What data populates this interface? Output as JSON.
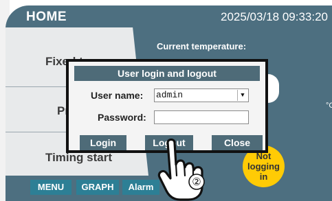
{
  "header": {
    "title": "HOME",
    "datetime": "2025/03/18  09:33:20"
  },
  "nav": {
    "items": [
      "Fixed temp",
      "Pr",
      "Timing start"
    ]
  },
  "main": {
    "current_temp_label": "Current temperature:",
    "unit": "°C"
  },
  "status": {
    "logging": "Not logging in"
  },
  "tabs": [
    "MENU",
    "GRAPH",
    "Alarm"
  ],
  "dialog": {
    "title": "User login and logout",
    "username_label": "User name:",
    "username_value": "admin",
    "password_label": "Password:",
    "password_value": "",
    "buttons": {
      "login": "Login",
      "logout": "Logout",
      "close": "Close"
    }
  },
  "annotation": {
    "step": "②"
  },
  "colors": {
    "panel": "#4d6f80",
    "button": "#4e6b78",
    "tab": "#2d7f95",
    "badge": "#ffcb05"
  }
}
